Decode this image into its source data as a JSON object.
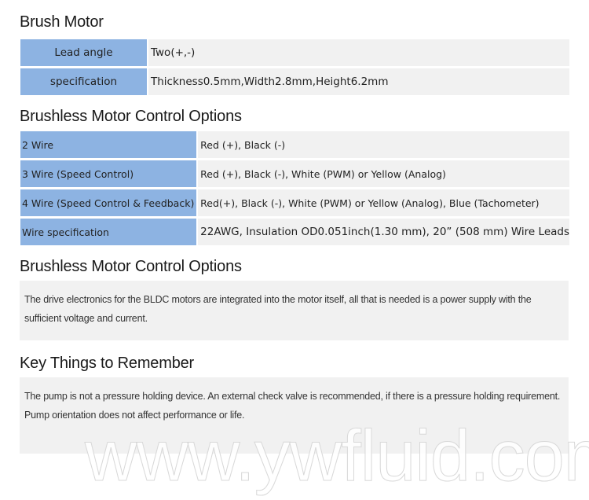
{
  "sections": {
    "brush_motor": {
      "title": "Brush Motor",
      "rows": [
        {
          "label": "Lead angle",
          "value": "Two(+,-)"
        },
        {
          "label": "specification",
          "value": "Thickness0.5mm,Width2.8mm,Height6.2mm"
        }
      ]
    },
    "brushless_options": {
      "title": "Brushless Motor Control Options",
      "rows": [
        {
          "label": "2 Wire",
          "value": "Red (+), Black (-)"
        },
        {
          "label": "3 Wire (Speed Control)",
          "value": "Red (+), Black (-), White (PWM) or Yellow (Analog)"
        },
        {
          "label": "4 Wire (Speed Control & Feedback)",
          "value": "Red(+), Black (-), White (PWM) or Yellow (Analog), Blue (Tachometer)"
        },
        {
          "label": "Wire specification",
          "value": "22AWG, Insulation OD0.051inch(1.30 mm), 20” (508 mm) Wire Leads"
        }
      ]
    },
    "brushless_text": {
      "title": "Brushless Motor Control Options",
      "paragraphs": [
        "The drive electronics for the BLDC motors are integrated into the motor itself, all that is needed is a power supply with the sufficient voltage and current."
      ]
    },
    "key_things": {
      "title": "Key Things to Remember",
      "paragraphs": [
        "The pump is not a pressure holding device. An external check valve is recommended, if there is a pressure holding requirement.",
        "Pump orientation does not affect performance or life."
      ]
    }
  },
  "watermark": "www.ywfluid.com",
  "colors": {
    "label_bg": "#8db3e2",
    "value_bg": "#f1f1f1"
  }
}
